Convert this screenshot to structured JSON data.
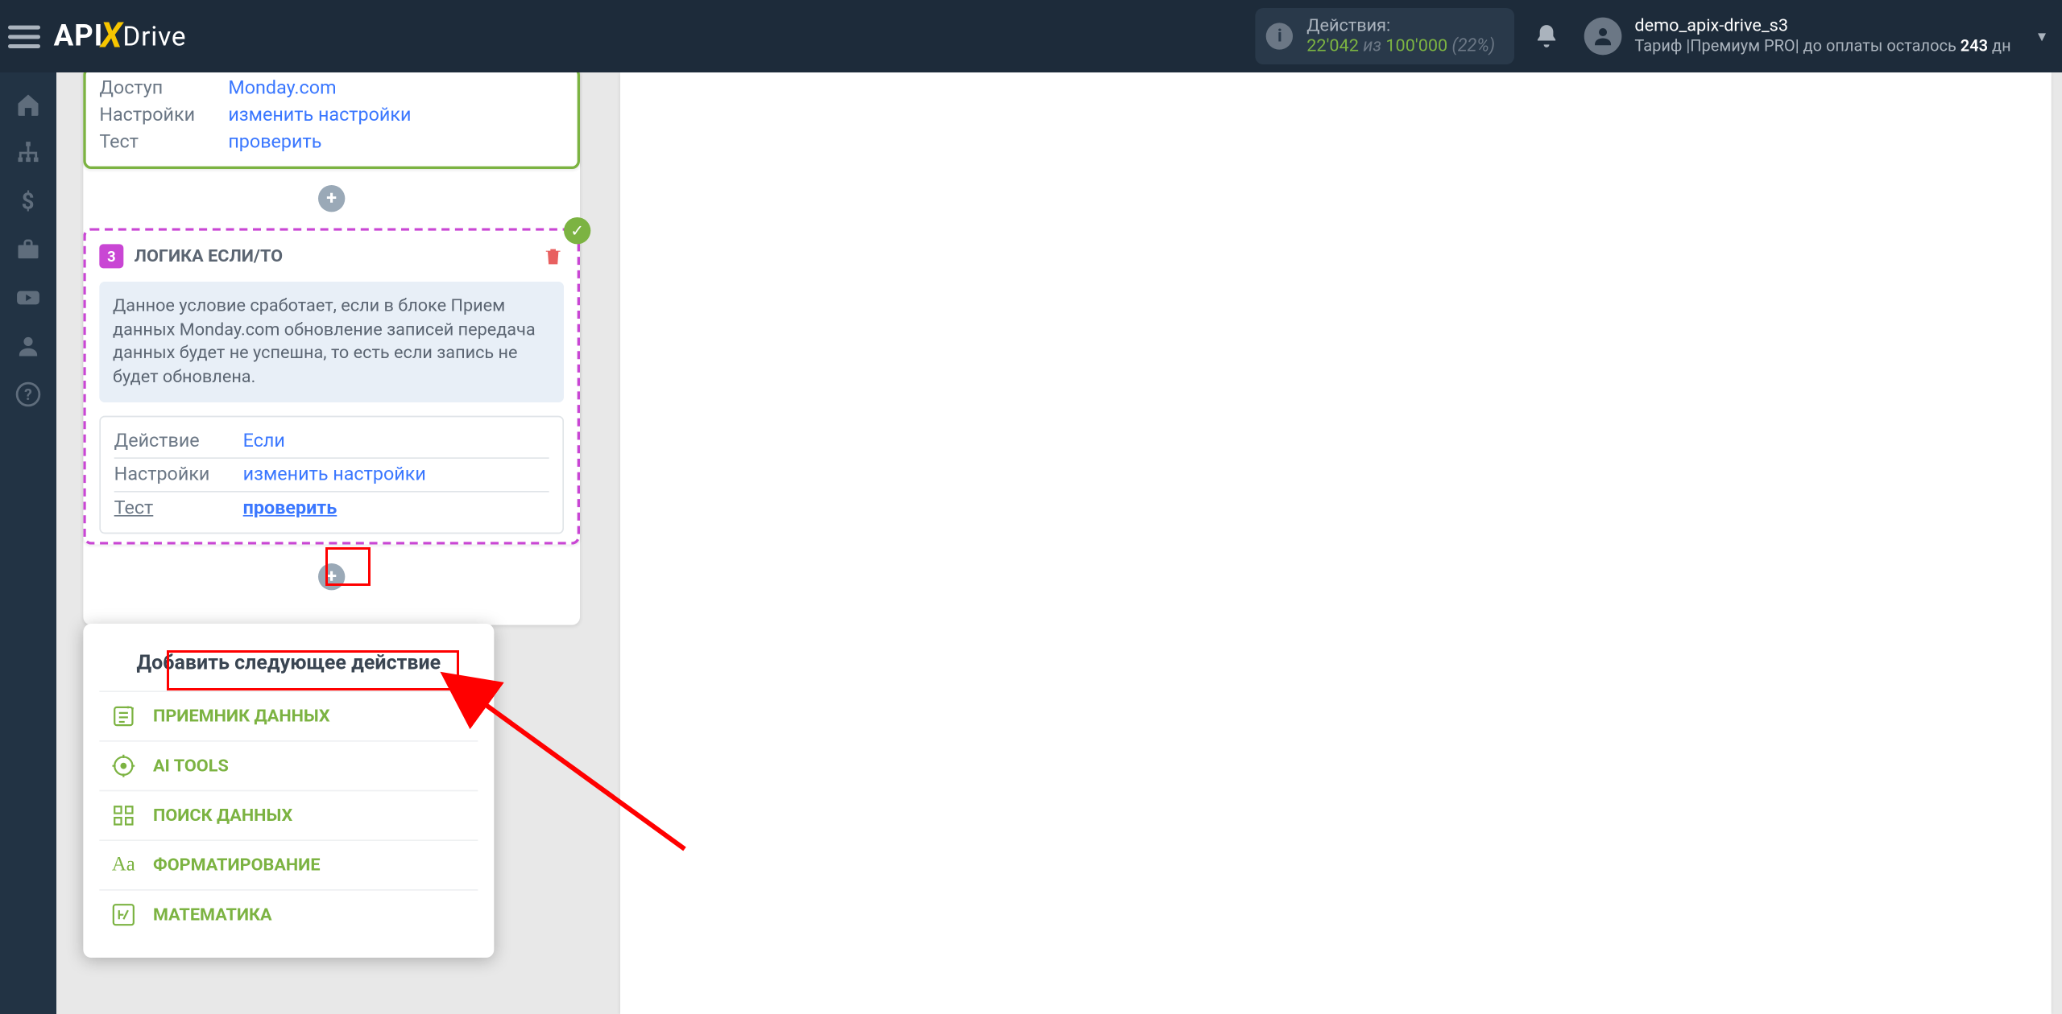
{
  "header": {
    "logo_api": "API",
    "logo_drive": "Drive",
    "actions_label": "Действия:",
    "actions_current": "22'042",
    "actions_sep": " из ",
    "actions_total": "100'000",
    "actions_pct": " (22%)",
    "user_name": "demo_apix-drive_s3",
    "tariff_prefix": "Тариф |Премиум PRO| до оплаты осталось ",
    "tariff_days": "243",
    "tariff_suffix": " дн"
  },
  "block1": {
    "access_label": "Доступ",
    "access_value": "Monday.com",
    "settings_label": "Настройки",
    "settings_value": "изменить настройки",
    "test_label": "Тест",
    "test_value": "проверить"
  },
  "block2": {
    "number": "3",
    "title": "ЛОГИКА ЕСЛИ/ТО",
    "info": "Данное условие сработает, если в блоке Прием данных Monday.com обновление записей передача данных будет не успешна, то есть если запись не будет обновлена.",
    "action_label": "Действие",
    "action_value": "Если",
    "settings_label": "Настройки",
    "settings_value": "изменить настройки",
    "test_label": "Тест",
    "test_value": "проверить"
  },
  "dropdown": {
    "heading": "Добавить следующее действие",
    "items": [
      {
        "label": "ПРИЕМНИК ДАННЫХ"
      },
      {
        "label": "AI TOOLS"
      },
      {
        "label": "ПОИСК ДАННЫХ"
      },
      {
        "label": "ФОРМАТИРОВАНИЕ"
      },
      {
        "label": "МАТЕМАТИКА"
      }
    ]
  }
}
